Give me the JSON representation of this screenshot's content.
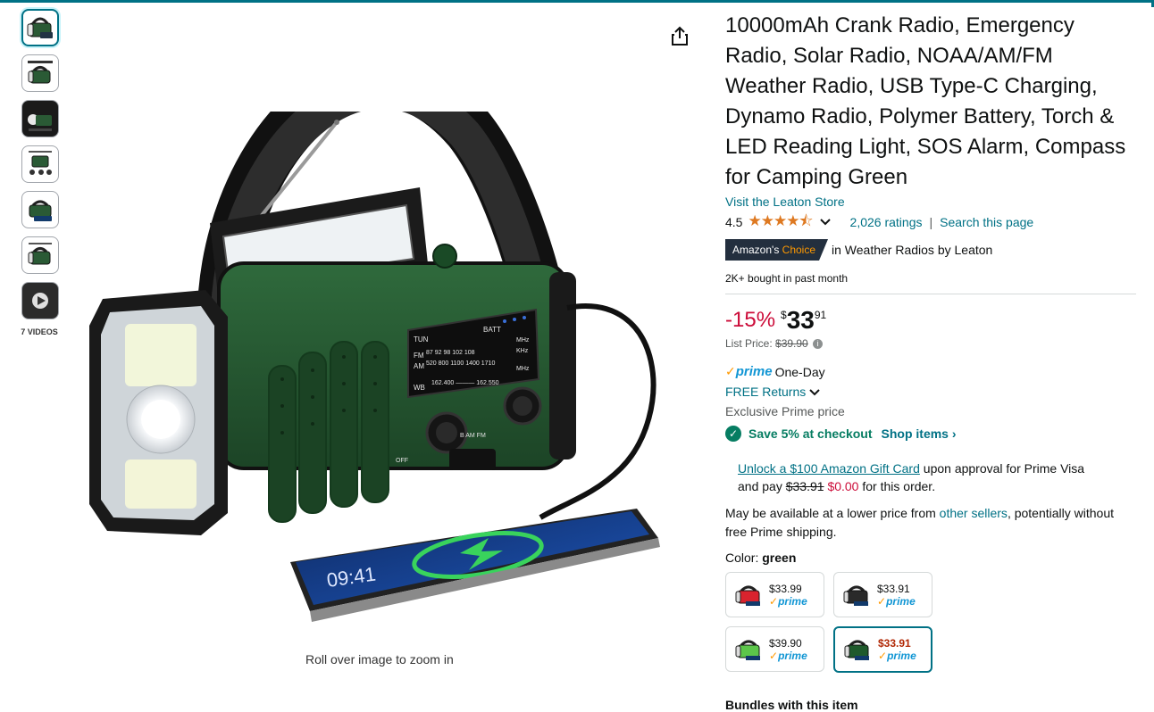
{
  "gallery": {
    "thumbnails": [
      {
        "icon": "radio-front-thumbnail",
        "selected": true
      },
      {
        "icon": "radio-battery-thumbnail",
        "selected": false
      },
      {
        "icon": "radio-light-thumbnail",
        "selected": false
      },
      {
        "icon": "radio-charging-thumbnail",
        "selected": false
      },
      {
        "icon": "radio-phone-thumbnail",
        "selected": false
      },
      {
        "icon": "radio-alt-thumbnail",
        "selected": false
      }
    ],
    "video_label": "7 VIDEOS",
    "zoom_hint": "Roll over image to zoom in"
  },
  "radio_display": {
    "row1": "TUN",
    "batt": "BATT",
    "fm_label": "FM",
    "fm_values": "87  92  98  102  108",
    "fm_unit": "MHz",
    "am_label": "AM",
    "am_values": "520  800  1100  1400  1710",
    "am_unit": "KHz",
    "wb_label": "WB",
    "wb_values": "162.400 ——— 162.550",
    "wb_unit": "MHz",
    "band_labels": "B AM FM",
    "off_label": "OFF",
    "phone_time": "09:41"
  },
  "product": {
    "title": "10000mAh Crank Radio, Emergency Radio, Solar Radio, NOAA/AM/FM Weather Radio, USB Type-C Charging, Dynamo Radio, Polymer Battery, Torch & LED Reading Light, SOS Alarm, Compass for Camping Green",
    "store_link": "Visit the Leaton Store",
    "rating": "4.5",
    "stars": "★★★★⯪",
    "ratings_count": "2,026 ratings",
    "search_page": "Search this page",
    "choice_badge_1": "Amazon's",
    "choice_badge_2": "Choice",
    "choice_text": "in Weather Radios by Leaton",
    "bought": "2K+ bought in past month"
  },
  "price": {
    "discount": "-15%",
    "currency": "$",
    "whole": "33",
    "fraction": "91",
    "list_label": "List Price:",
    "list_value": "$39.90",
    "prime_check": "✓",
    "prime_word": "prime",
    "prime_text": "One-Day",
    "returns": "FREE Returns",
    "exclusive": "Exclusive Prime price",
    "save_text": "Save 5% at checkout",
    "shop_items": "Shop items",
    "card_link": "Unlock a $100 Amazon Gift Card",
    "card_text_1": "upon approval for Prime Visa",
    "card_text_2": "and pay",
    "card_old": "$33.91",
    "card_new": "$0.00",
    "card_text_3": "for this order.",
    "avail_1": "May be available at a lower price from",
    "avail_link": "other sellers",
    "avail_2": ", potentially without free Prime shipping."
  },
  "color": {
    "label": "Color:",
    "value": "green",
    "options": [
      {
        "price": "$33.99",
        "prime": "prime",
        "color": "#d9232e",
        "selected": false
      },
      {
        "price": "$33.91",
        "prime": "prime",
        "color": "#222222",
        "selected": false
      },
      {
        "price": "$39.90",
        "prime": "prime",
        "color": "#5cc64a",
        "selected": false
      },
      {
        "price": "$33.91",
        "prime": "prime",
        "color": "#1f5a2c",
        "selected": true
      }
    ]
  },
  "bundles_label": "Bundles with this item",
  "colors": {
    "link": "#007185",
    "discount": "#cc0c39",
    "prime_blue": "#1196d4",
    "star": "#de7921",
    "radio_green": "#2a5a35"
  }
}
